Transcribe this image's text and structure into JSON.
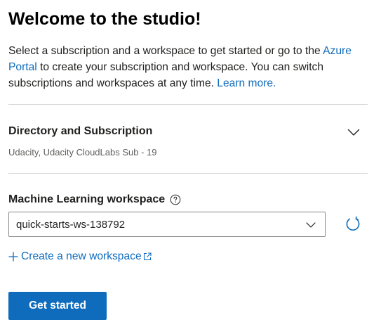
{
  "header": {
    "title": "Welcome to the studio!"
  },
  "intro": {
    "text_before_portal": "Select a subscription and a workspace to get started or go to the ",
    "portal_link": "Azure Portal",
    "text_after_portal": " to create your subscription and workspace. You can switch subscriptions and workspaces at any time. ",
    "learn_more_link": "Learn more."
  },
  "directory": {
    "label": "Directory and Subscription",
    "value": "Udacity, Udacity CloudLabs Sub - 19",
    "icon": "chevron-down-icon"
  },
  "workspace": {
    "label": "Machine Learning workspace",
    "help_icon": "question-circle-icon",
    "selected": "quick-starts-ws-138792",
    "dropdown_icon": "chevron-down-icon",
    "refresh_icon": "refresh-icon"
  },
  "create": {
    "label": "Create a new workspace",
    "icons": [
      "plus-icon",
      "external-link-icon"
    ]
  },
  "actions": {
    "primary_label": "Get started"
  },
  "colors": {
    "accent": "#0f6cbd",
    "text": "#201f1e",
    "secondary_text": "#605e5c",
    "divider": "#d6d6d6",
    "border": "#8a8886"
  }
}
